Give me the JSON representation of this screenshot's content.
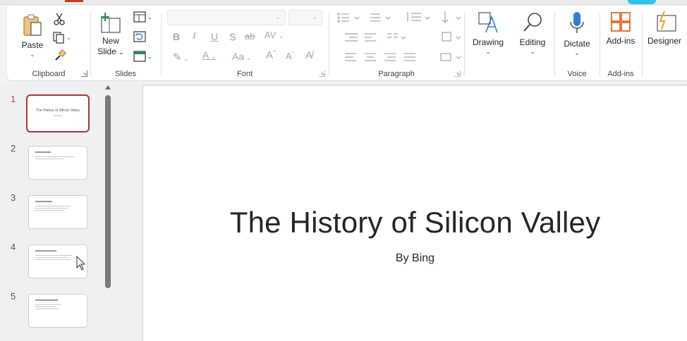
{
  "ribbon": {
    "clipboard": {
      "paste_label": "Paste",
      "group_label": "Clipboard"
    },
    "slides": {
      "new_slide_label_line1": "New",
      "new_slide_label_line2": "Slide",
      "group_label": "Slides"
    },
    "font": {
      "bold": "B",
      "italic": "I",
      "underline": "U",
      "shadow": "S",
      "strikethrough": "ab",
      "spacing": "AV",
      "font_color": "A",
      "change_case": "Aa",
      "grow": "A",
      "shrink": "A",
      "group_label": "Font"
    },
    "paragraph": {
      "group_label": "Paragraph"
    },
    "drawing_label": "Drawing",
    "editing_label": "Editing",
    "voice": {
      "dictate_label": "Dictate",
      "group_label": "Voice"
    },
    "addins": {
      "addins_label": "Add-ins",
      "group_label": "Add-ins"
    },
    "designer_label": "Designer"
  },
  "thumbnails": [
    {
      "number": "1",
      "title": "The History of Silicon Valley",
      "subtitle": "By Bing",
      "active": true
    },
    {
      "number": "2",
      "active": false
    },
    {
      "number": "3",
      "active": false
    },
    {
      "number": "4",
      "active": false
    },
    {
      "number": "5",
      "active": false
    }
  ],
  "slide": {
    "title": "The History of Silicon Valley",
    "subtitle": "By Bing"
  },
  "colors": {
    "accent": "#c43e1c",
    "active_thumb_border": "#a4373a",
    "dictate_blue": "#2f7ed8",
    "addins_orange": "#e06a2c"
  }
}
